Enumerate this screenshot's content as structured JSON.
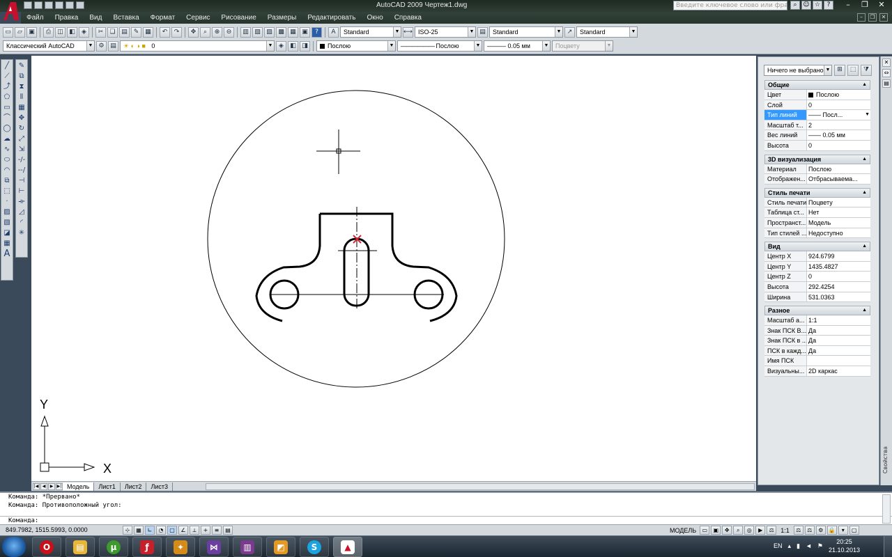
{
  "window": {
    "title": "AutoCAD 2009 Чертеж1.dwg",
    "search_placeholder": "Введите ключевое слово или фразу",
    "controls": [
      "–",
      "❐",
      "✕"
    ]
  },
  "menu": [
    "Файл",
    "Правка",
    "Вид",
    "Вставка",
    "Формат",
    "Сервис",
    "Рисование",
    "Размеры",
    "Редактировать",
    "Окно",
    "Справка"
  ],
  "toolbar": {
    "text_style": "Standard",
    "dim_style": "ISO-25",
    "table_style": "Standard",
    "mleader_style": "Standard",
    "workspace": "Классический AutoCAD",
    "layer": "0",
    "color": "Послою",
    "linetype": "Послою",
    "lineweight": "0.05 мм",
    "plotstyle": "Поцвету"
  },
  "layout_tabs": [
    "Модель",
    "Лист1",
    "Лист2",
    "Лист3"
  ],
  "ucs": {
    "x_label": "X",
    "y_label": "Y"
  },
  "properties": {
    "selection": "Ничего не выбрано",
    "sections": [
      {
        "title": "Общие",
        "rows": [
          {
            "key": "Цвет",
            "value": "Послою",
            "swatch": true
          },
          {
            "key": "Слой",
            "value": "0"
          },
          {
            "key": "Тип линий",
            "value": "—— Посл...",
            "selected": true
          },
          {
            "key": "Масштаб т...",
            "value": "2"
          },
          {
            "key": "Вес линий",
            "value": "—— 0.05 мм"
          },
          {
            "key": "Высота",
            "value": "0"
          }
        ]
      },
      {
        "title": "3D визуализация",
        "rows": [
          {
            "key": "Материал",
            "value": "Послою"
          },
          {
            "key": "Отображен...",
            "value": "Отбрасываема..."
          }
        ]
      },
      {
        "title": "Стиль печати",
        "rows": [
          {
            "key": "Стиль печати",
            "value": "Поцвету"
          },
          {
            "key": "Таблица ст...",
            "value": "Нет"
          },
          {
            "key": "Пространст...",
            "value": "Модель"
          },
          {
            "key": "Тип стилей ...",
            "value": "Недоступно"
          }
        ]
      },
      {
        "title": "Вид",
        "rows": [
          {
            "key": "Центр X",
            "value": "924.6799"
          },
          {
            "key": "Центр Y",
            "value": "1435.4827"
          },
          {
            "key": "Центр Z",
            "value": "0"
          },
          {
            "key": "Высота",
            "value": "292.4254"
          },
          {
            "key": "Ширина",
            "value": "531.0363"
          }
        ]
      },
      {
        "title": "Разное",
        "rows": [
          {
            "key": "Масштаб а...",
            "value": "1:1"
          },
          {
            "key": "Знак ПСК В...",
            "value": "Да"
          },
          {
            "key": "Знак ПСК в ...",
            "value": "Да"
          },
          {
            "key": "ПСК в кажд...",
            "value": "Да"
          },
          {
            "key": "Имя ПСК",
            "value": ""
          },
          {
            "key": "Визуальны...",
            "value": "2D каркас"
          }
        ]
      }
    ],
    "strip_title": "Свойства"
  },
  "command_lines": [
    "Команда: *Прервано*",
    "Команда: Противоположный угол:",
    "Команда:"
  ],
  "status": {
    "coords": "849.7982, 1515.5993, 0.0000",
    "model_label": "МОДЕЛЬ",
    "annotation_scale": "1:1"
  },
  "taskbar": {
    "lang": "EN",
    "time": "20:25",
    "date": "21.10.2013"
  },
  "colors": {
    "autocad_red": "#c8102e",
    "selection_blue": "#3399ff",
    "cursor_marker": "#d9232e"
  }
}
